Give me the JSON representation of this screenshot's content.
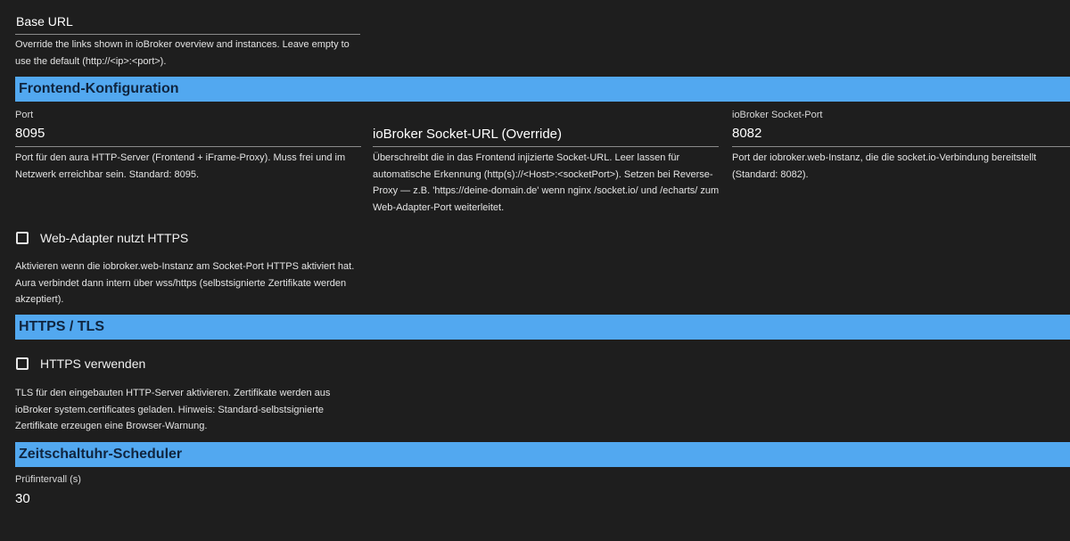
{
  "base_url": {
    "label": "Base URL",
    "help": "Override the links shown in ioBroker overview and instances. Leave empty to use the default (http://<ip>:<port>)."
  },
  "sections": {
    "frontend": "Frontend-Konfiguration",
    "https": "HTTPS / TLS",
    "scheduler": "Zeitschaltuhr-Scheduler"
  },
  "port": {
    "label": "Port",
    "value": "8095",
    "help": "Port für den aura HTTP-Server (Frontend + iFrame-Proxy). Muss frei und im Netzwerk erreichbar sein. Standard: 8095."
  },
  "socket_url": {
    "label": "ioBroker Socket-URL (Override)",
    "help": "Überschreibt die in das Frontend injizierte Socket-URL. Leer lassen für automatische Erkennung (http(s)://<Host>:<socketPort>). Setzen bei Reverse-Proxy — z.B. 'https://deine-domain.de' wenn nginx /socket.io/ und /echarts/ zum Web-Adapter-Port weiterleitet."
  },
  "socket_port": {
    "label": "ioBroker Socket-Port",
    "value": "8082",
    "help": "Port der iobroker.web-Instanz, die die socket.io-Verbindung bereitstellt (Standard: 8082)."
  },
  "web_https": {
    "label": "Web-Adapter nutzt HTTPS",
    "help": "Aktivieren wenn die iobroker.web-Instanz am Socket-Port HTTPS aktiviert hat. Aura verbindet dann intern über wss/https (selbstsignierte Zertifikate werden akzeptiert)."
  },
  "use_https": {
    "label": "HTTPS verwenden",
    "help": "TLS für den eingebauten HTTP-Server aktivieren. Zertifikate werden aus ioBroker system.certificates geladen. Hinweis: Standard-selbstsignierte Zertifikate erzeugen eine Browser-Warnung."
  },
  "interval": {
    "label": "Prüfintervall (s)",
    "value": "30"
  }
}
